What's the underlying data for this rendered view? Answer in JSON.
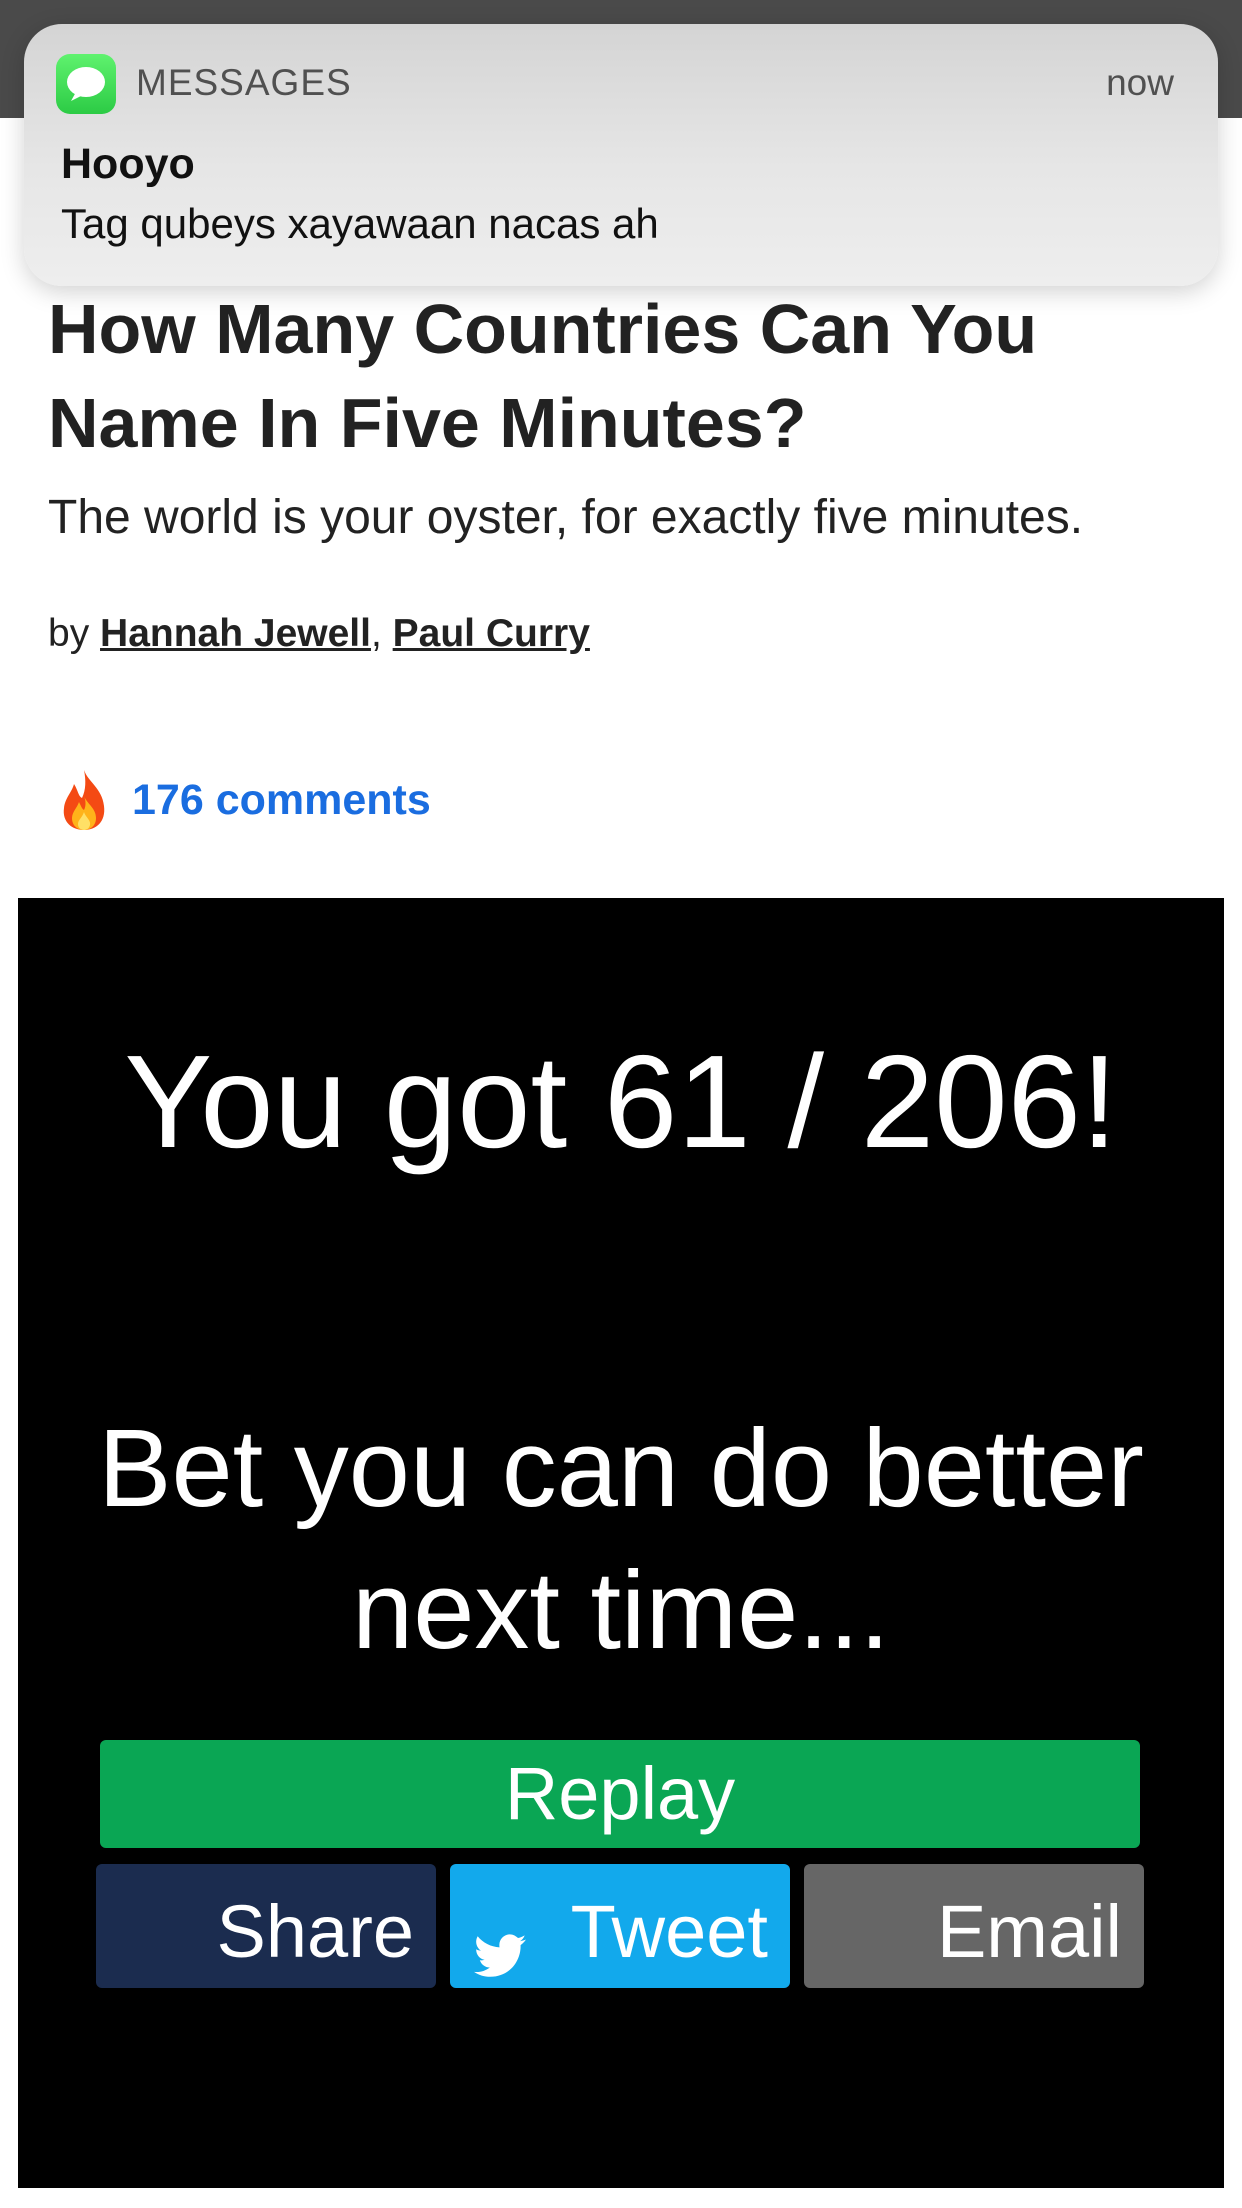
{
  "notification": {
    "app_name": "MESSAGES",
    "time": "now",
    "sender": "Hooyo",
    "message": "Tag qubeys xayawaan nacas ah",
    "icon": "messages-icon"
  },
  "article": {
    "title": "How Many Countries Can You Name In Five Minutes?",
    "subtitle": "The world is your oyster, for exactly five minutes.",
    "byline_prefix": "by ",
    "author_1": "Hannah Jewell",
    "author_separator": ",",
    "author_2": "Paul Curry",
    "comments_icon": "fire-icon",
    "comments_label": "176 comments"
  },
  "quiz": {
    "score": "You got 61 / 206!",
    "message": "Bet you can do better next time...",
    "replay_label": "Replay",
    "share_label": "Share",
    "tweet_label": "Tweet",
    "email_label": "Email"
  },
  "colors": {
    "link_blue": "#1a6de0",
    "replay_green": "#0aa654",
    "facebook_navy": "#1b2c4f",
    "twitter_blue": "#12a9ec",
    "email_gray": "#666666",
    "panel_black": "#000000"
  }
}
